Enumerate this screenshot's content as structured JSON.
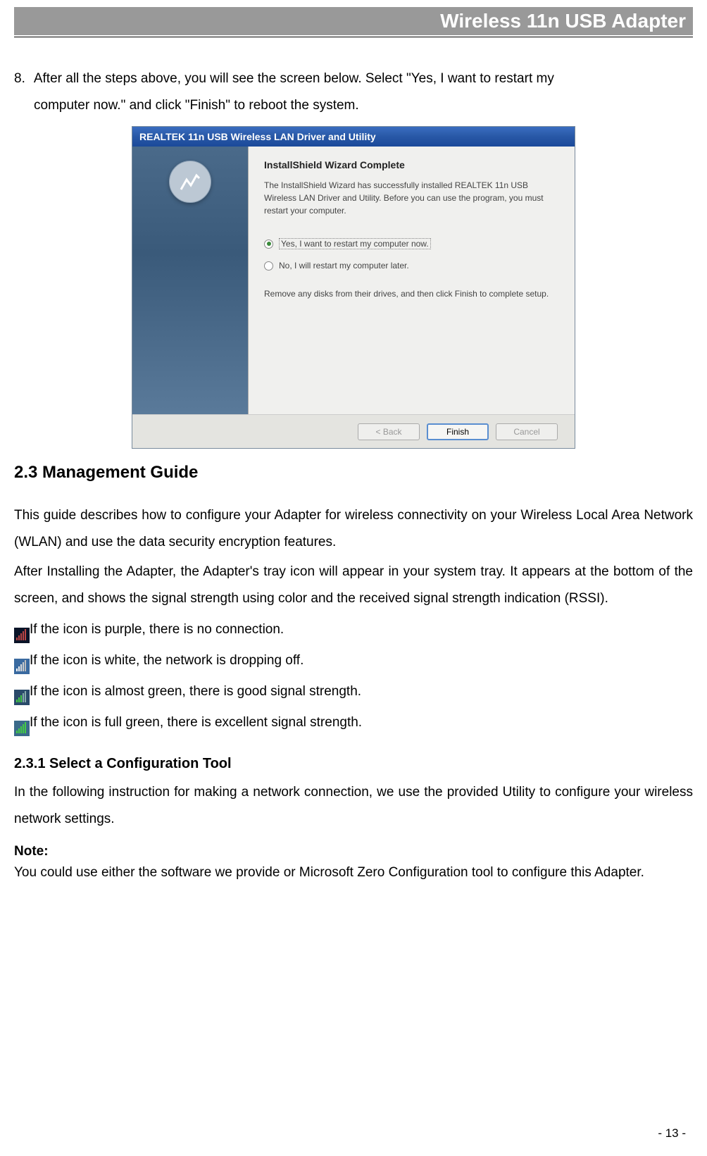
{
  "header": {
    "title": "Wireless 11n USB Adapter"
  },
  "step": {
    "num": "8.",
    "text_line1": "After all the steps above, you will see the screen below. Select \"Yes, I want to restart my",
    "text_line2": "computer now.\" and click \"Finish\" to reboot the system."
  },
  "dialog": {
    "title": "REALTEK 11n USB Wireless LAN Driver and Utility",
    "heading": "InstallShield Wizard Complete",
    "para1": "The InstallShield Wizard has successfully installed REALTEK 11n USB Wireless LAN Driver and Utility.  Before you can use the program, you must restart your computer.",
    "radio_yes": "Yes, I want to restart my computer now.",
    "radio_no": "No, I will restart my computer later.",
    "para2": "Remove any disks from their drives, and then click Finish to complete setup.",
    "btn_back": "< Back",
    "btn_finish": "Finish",
    "btn_cancel": "Cancel"
  },
  "h2": "2.3 Management Guide",
  "mg_p1": "This guide describes how to configure your Adapter for wireless connectivity on your Wireless Local Area Network (WLAN) and use the data security encryption features.",
  "mg_p2": "After Installing the Adapter, the Adapter's tray icon will appear in your system tray. It appears at the bottom of the screen, and shows the signal strength using color and the received signal strength indication (RSSI).",
  "icons": {
    "purple": "If the icon is purple, there is no connection.",
    "white": "If the icon is white, the network is dropping off.",
    "almost_green": "If the icon is almost green, there is good signal strength.",
    "full_green": "If the icon is full green, there is excellent signal strength."
  },
  "h3": "2.3.1    Select a Configuration Tool",
  "cfg_p1": "In the following instruction for making a network connection, we use the provided Utility to configure your wireless network settings.",
  "note_label": "Note:",
  "note_text": "You could use either the software we provide or Microsoft Zero Configuration tool to configure this Adapter.",
  "pagenum": "- 13 -"
}
